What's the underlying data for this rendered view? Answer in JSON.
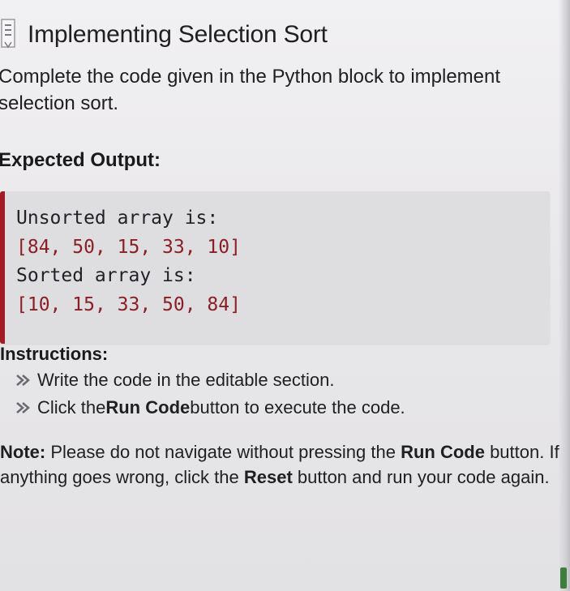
{
  "title": "Implementing Selection Sort",
  "description": "Complete the code given in the Python block to implement selection sort.",
  "expected_label": "Expected Output:",
  "code_lines": [
    "Unsorted array is:",
    "[84, 50, 15, 33, 10]",
    "Sorted array is:",
    "[10, 15, 33, 50, 84]"
  ],
  "instructions_label": "Instructions:",
  "instructions": [
    {
      "pre": "Write the code in the editable section.",
      "bold": "",
      "post": ""
    },
    {
      "pre": "Click the ",
      "bold": "Run Code",
      "post": " button to execute the code."
    }
  ],
  "note": {
    "label": "Note:",
    "text1": " Please do not navigate without pressing the ",
    "bold1": "Run Code",
    "text2": " button. If anything goes wrong, click the ",
    "bold2": "Reset",
    "text3": " button and run your code again."
  },
  "colors": {
    "accent_border": "#a31c24",
    "code_background": "#dedde0"
  },
  "icons": {
    "header": "book-icon",
    "bullet": "chevron-double-right-icon"
  }
}
